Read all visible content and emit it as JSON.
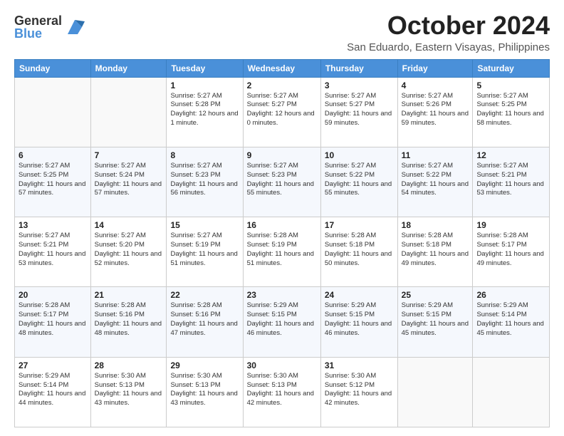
{
  "logo": {
    "general": "General",
    "blue": "Blue"
  },
  "title": "October 2024",
  "subtitle": "San Eduardo, Eastern Visayas, Philippines",
  "days_header": [
    "Sunday",
    "Monday",
    "Tuesday",
    "Wednesday",
    "Thursday",
    "Friday",
    "Saturday"
  ],
  "weeks": [
    [
      {
        "num": "",
        "info": ""
      },
      {
        "num": "",
        "info": ""
      },
      {
        "num": "1",
        "info": "Sunrise: 5:27 AM\nSunset: 5:28 PM\nDaylight: 12 hours\nand 1 minute."
      },
      {
        "num": "2",
        "info": "Sunrise: 5:27 AM\nSunset: 5:27 PM\nDaylight: 12 hours\nand 0 minutes."
      },
      {
        "num": "3",
        "info": "Sunrise: 5:27 AM\nSunset: 5:27 PM\nDaylight: 11 hours\nand 59 minutes."
      },
      {
        "num": "4",
        "info": "Sunrise: 5:27 AM\nSunset: 5:26 PM\nDaylight: 11 hours\nand 59 minutes."
      },
      {
        "num": "5",
        "info": "Sunrise: 5:27 AM\nSunset: 5:25 PM\nDaylight: 11 hours\nand 58 minutes."
      }
    ],
    [
      {
        "num": "6",
        "info": "Sunrise: 5:27 AM\nSunset: 5:25 PM\nDaylight: 11 hours\nand 57 minutes."
      },
      {
        "num": "7",
        "info": "Sunrise: 5:27 AM\nSunset: 5:24 PM\nDaylight: 11 hours\nand 57 minutes."
      },
      {
        "num": "8",
        "info": "Sunrise: 5:27 AM\nSunset: 5:23 PM\nDaylight: 11 hours\nand 56 minutes."
      },
      {
        "num": "9",
        "info": "Sunrise: 5:27 AM\nSunset: 5:23 PM\nDaylight: 11 hours\nand 55 minutes."
      },
      {
        "num": "10",
        "info": "Sunrise: 5:27 AM\nSunset: 5:22 PM\nDaylight: 11 hours\nand 55 minutes."
      },
      {
        "num": "11",
        "info": "Sunrise: 5:27 AM\nSunset: 5:22 PM\nDaylight: 11 hours\nand 54 minutes."
      },
      {
        "num": "12",
        "info": "Sunrise: 5:27 AM\nSunset: 5:21 PM\nDaylight: 11 hours\nand 53 minutes."
      }
    ],
    [
      {
        "num": "13",
        "info": "Sunrise: 5:27 AM\nSunset: 5:21 PM\nDaylight: 11 hours\nand 53 minutes."
      },
      {
        "num": "14",
        "info": "Sunrise: 5:27 AM\nSunset: 5:20 PM\nDaylight: 11 hours\nand 52 minutes."
      },
      {
        "num": "15",
        "info": "Sunrise: 5:27 AM\nSunset: 5:19 PM\nDaylight: 11 hours\nand 51 minutes."
      },
      {
        "num": "16",
        "info": "Sunrise: 5:28 AM\nSunset: 5:19 PM\nDaylight: 11 hours\nand 51 minutes."
      },
      {
        "num": "17",
        "info": "Sunrise: 5:28 AM\nSunset: 5:18 PM\nDaylight: 11 hours\nand 50 minutes."
      },
      {
        "num": "18",
        "info": "Sunrise: 5:28 AM\nSunset: 5:18 PM\nDaylight: 11 hours\nand 49 minutes."
      },
      {
        "num": "19",
        "info": "Sunrise: 5:28 AM\nSunset: 5:17 PM\nDaylight: 11 hours\nand 49 minutes."
      }
    ],
    [
      {
        "num": "20",
        "info": "Sunrise: 5:28 AM\nSunset: 5:17 PM\nDaylight: 11 hours\nand 48 minutes."
      },
      {
        "num": "21",
        "info": "Sunrise: 5:28 AM\nSunset: 5:16 PM\nDaylight: 11 hours\nand 48 minutes."
      },
      {
        "num": "22",
        "info": "Sunrise: 5:28 AM\nSunset: 5:16 PM\nDaylight: 11 hours\nand 47 minutes."
      },
      {
        "num": "23",
        "info": "Sunrise: 5:29 AM\nSunset: 5:15 PM\nDaylight: 11 hours\nand 46 minutes."
      },
      {
        "num": "24",
        "info": "Sunrise: 5:29 AM\nSunset: 5:15 PM\nDaylight: 11 hours\nand 46 minutes."
      },
      {
        "num": "25",
        "info": "Sunrise: 5:29 AM\nSunset: 5:15 PM\nDaylight: 11 hours\nand 45 minutes."
      },
      {
        "num": "26",
        "info": "Sunrise: 5:29 AM\nSunset: 5:14 PM\nDaylight: 11 hours\nand 45 minutes."
      }
    ],
    [
      {
        "num": "27",
        "info": "Sunrise: 5:29 AM\nSunset: 5:14 PM\nDaylight: 11 hours\nand 44 minutes."
      },
      {
        "num": "28",
        "info": "Sunrise: 5:30 AM\nSunset: 5:13 PM\nDaylight: 11 hours\nand 43 minutes."
      },
      {
        "num": "29",
        "info": "Sunrise: 5:30 AM\nSunset: 5:13 PM\nDaylight: 11 hours\nand 43 minutes."
      },
      {
        "num": "30",
        "info": "Sunrise: 5:30 AM\nSunset: 5:13 PM\nDaylight: 11 hours\nand 42 minutes."
      },
      {
        "num": "31",
        "info": "Sunrise: 5:30 AM\nSunset: 5:12 PM\nDaylight: 11 hours\nand 42 minutes."
      },
      {
        "num": "",
        "info": ""
      },
      {
        "num": "",
        "info": ""
      }
    ]
  ]
}
